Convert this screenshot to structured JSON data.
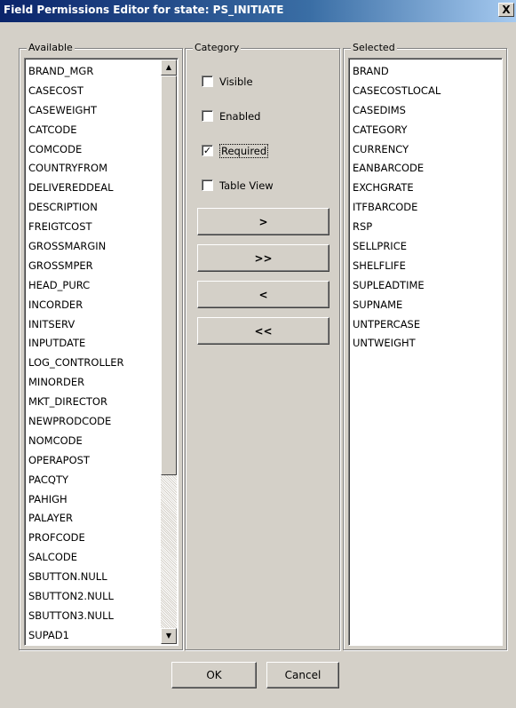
{
  "window": {
    "title": "Field Permissions Editor for state: PS_INITIATE",
    "close_label": "X"
  },
  "available": {
    "legend": "Available",
    "items": [
      "BRAND_MGR",
      "CASECOST",
      "CASEWEIGHT",
      "CATCODE",
      "COMCODE",
      "COUNTRYFROM",
      "DELIVEREDDEAL",
      "DESCRIPTION",
      "FREIGTCOST",
      "GROSSMARGIN",
      "GROSSMPER",
      "HEAD_PURC",
      "INCORDER",
      "INITSERV",
      "INPUTDATE",
      "LOG_CONTROLLER",
      "MINORDER",
      "MKT_DIRECTOR",
      "NEWPRODCODE",
      "NOMCODE",
      "OPERAPOST",
      "PACQTY",
      "PAHIGH",
      "PALAYER",
      "PROFCODE",
      "SALCODE",
      "SBUTTON.NULL",
      "SBUTTON2.NULL",
      "SBUTTON3.NULL",
      "SUPAD1"
    ],
    "scroll_up_icon": "▲",
    "scroll_down_icon": "▼"
  },
  "category": {
    "legend": "Category",
    "checkboxes": [
      {
        "label": "Visible",
        "checked": false
      },
      {
        "label": "Enabled",
        "checked": false
      },
      {
        "label": "Required",
        "checked": true
      },
      {
        "label": "Table View",
        "checked": false
      }
    ],
    "check_mark": "✓",
    "buttons": {
      "add": ">",
      "add_all": ">>",
      "remove": "<",
      "remove_all": "<<"
    }
  },
  "selected": {
    "legend": "Selected",
    "items": [
      "BRAND",
      "CASECOSTLOCAL",
      "CASEDIMS",
      "CATEGORY",
      "CURRENCY",
      "EANBARCODE",
      "EXCHGRATE",
      "ITFBARCODE",
      "RSP",
      "SELLPRICE",
      "SHELFLIFE",
      "SUPLEADTIME",
      "SUPNAME",
      "UNTPERCASE",
      "UNTWEIGHT"
    ]
  },
  "footer": {
    "ok_label": "OK",
    "cancel_label": "Cancel"
  }
}
